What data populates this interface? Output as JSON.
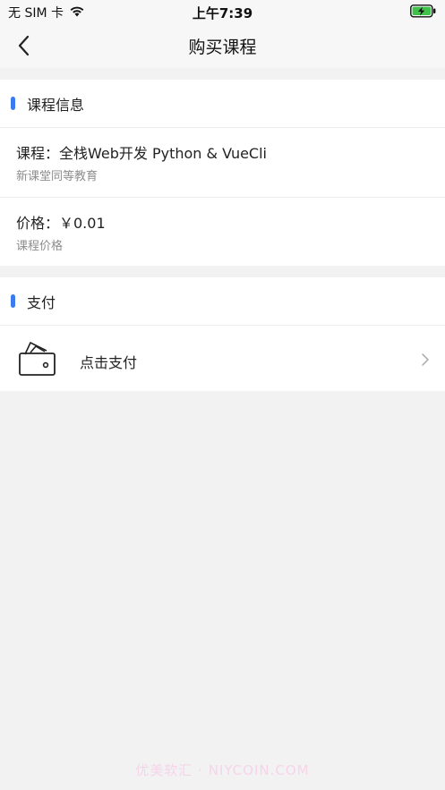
{
  "status_bar": {
    "carrier": "无 SIM 卡",
    "time": "上午7:39",
    "wifi_icon": "wifi-icon",
    "battery_icon": "battery-charging-icon",
    "battery_color": "#3fc14a"
  },
  "nav": {
    "back_icon": "chevron-left-icon",
    "title": "购买课程"
  },
  "course_section": {
    "title": "课程信息",
    "accent_color": "#3a7bf0",
    "course": {
      "main": "课程：全栈Web开发 Python & VueCli",
      "sub": "新课堂同等教育"
    },
    "price": {
      "main": "价格：￥0.01",
      "sub": "课程价格"
    }
  },
  "payment_section": {
    "title": "支付",
    "pay_icon": "wallet-icon",
    "pay_label": "点击支付",
    "chevron_icon": "chevron-right-icon"
  },
  "watermark": "优美软汇 · NIYCOIN.COM"
}
